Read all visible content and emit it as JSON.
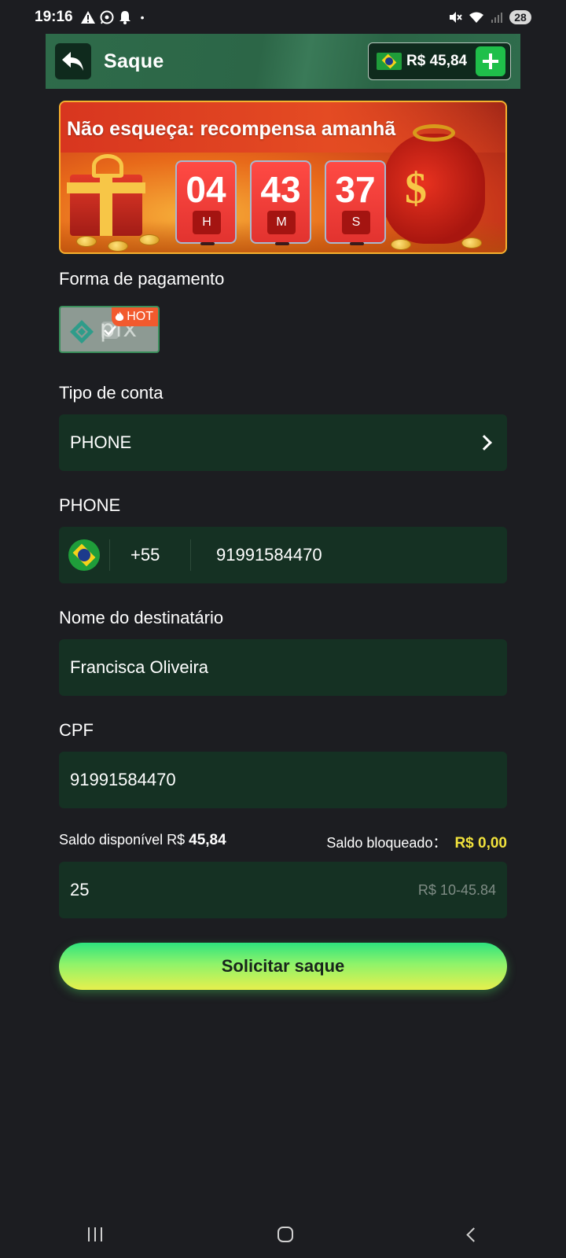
{
  "status_bar": {
    "time": "19:16",
    "battery": "28",
    "dot": "•"
  },
  "header": {
    "title": "Saque",
    "balance": "R$ 45,84"
  },
  "banner": {
    "title": "Não esqueça: recompensa amanhã",
    "timer": [
      {
        "value": "04",
        "unit": "H"
      },
      {
        "value": "43",
        "unit": "M"
      },
      {
        "value": "37",
        "unit": "S"
      }
    ],
    "dollar": "$"
  },
  "payment": {
    "label": "Forma de pagamento",
    "method": "pix",
    "hot_label": "HOT"
  },
  "account_type": {
    "label": "Tipo de conta",
    "value": "PHONE"
  },
  "phone": {
    "label": "PHONE",
    "country_code": "+55",
    "number": "91991584470"
  },
  "recipient": {
    "label": "Nome do destinatário",
    "value": "Francisca Oliveira"
  },
  "cpf": {
    "label": "CPF",
    "value": "91991584470"
  },
  "balances": {
    "available_label": "Saldo disponível R$",
    "available_value": "45,84",
    "blocked_label": "Saldo bloqueado：",
    "blocked_value": "R$ 0,00"
  },
  "amount": {
    "value": "25",
    "range_hint": "R$ 10-45.84"
  },
  "submit_label": "Solicitar saque",
  "colors": {
    "background": "#1c1d21",
    "field_bg": "#153123",
    "header_green": "#2e6b4a",
    "accent_yellow": "#f1e23c",
    "button_gradient_top": "#2ee37e",
    "button_gradient_bottom": "#e7f04d"
  }
}
